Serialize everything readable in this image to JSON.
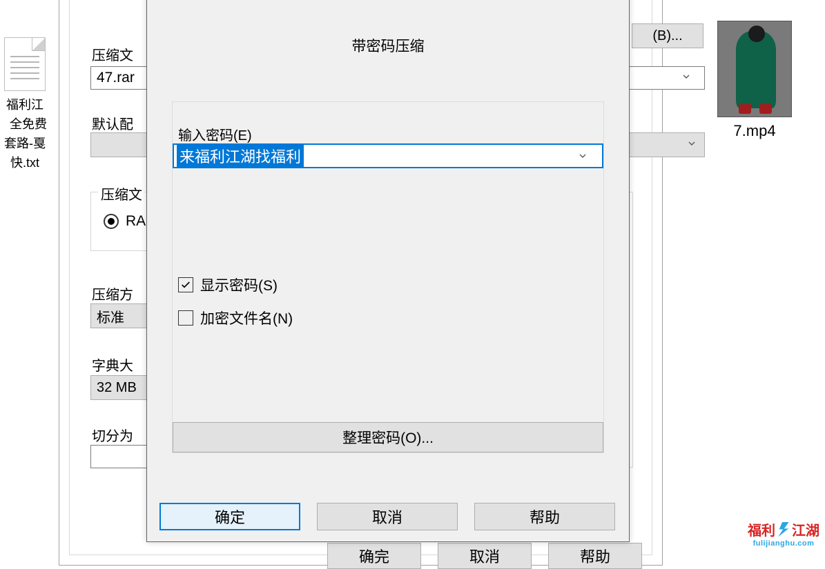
{
  "desktop": {
    "txt_filename": "福利江\n  全免费\n套路-戛\n快.txt",
    "video_filename": "7.mp4"
  },
  "parent_dialog": {
    "archive_label_partial": "压缩文",
    "archive_name": "47.rar",
    "browse_label": "(B)...",
    "profile_label_partial": "默认配",
    "format_group_label_partial": "压缩文",
    "radio_rar_partial": "RA",
    "method_label_partial": "压缩方",
    "method_value": "标准",
    "dict_label_partial": "字典大",
    "dict_value": "32 MB",
    "split_label_partial": "切分为",
    "btn_ok_partial": "确完",
    "btn_cancel_partial": "取消",
    "btn_help_partial": "帮助"
  },
  "password_dialog": {
    "title": "带密码压缩",
    "enter_label": "输入密码(E)",
    "entered_value": "来福利江湖找福利",
    "show_password": "显示密码(S)",
    "encrypt_names": "加密文件名(N)",
    "manage_btn": "整理密码(O)...",
    "ok": "确定",
    "cancel": "取消",
    "help": "帮助"
  },
  "watermark": {
    "cn_l": "福利",
    "cn_r": "江湖",
    "site": "fulijianghu.com"
  }
}
